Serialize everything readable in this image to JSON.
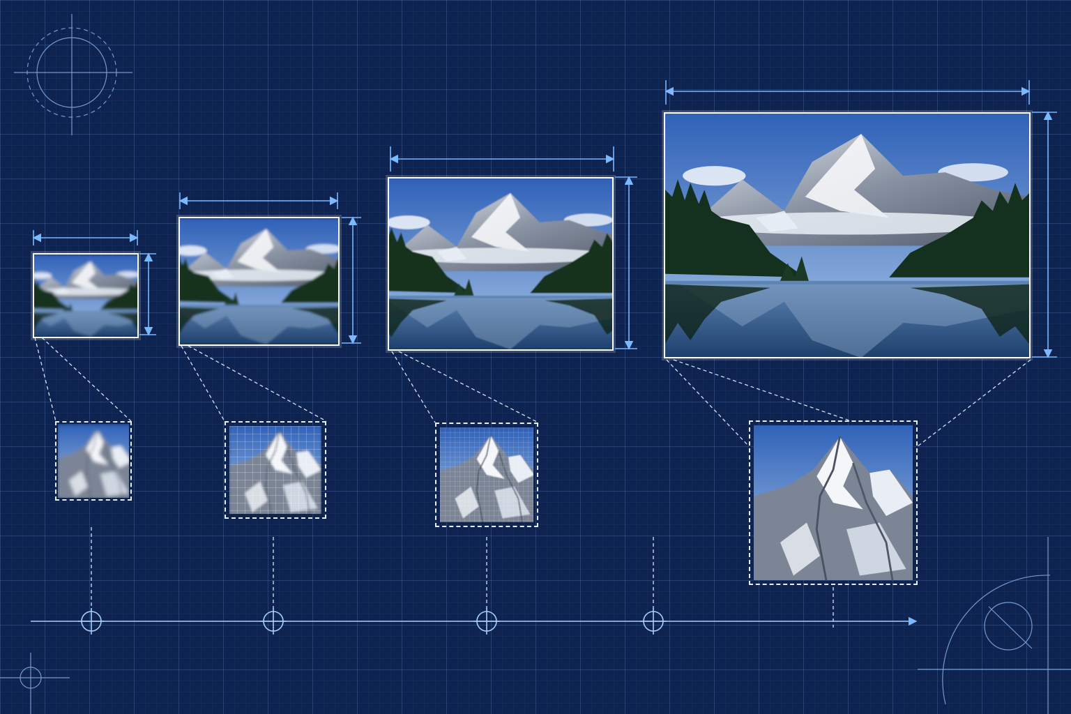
{
  "diagram": {
    "colors": {
      "background": "#0e2350",
      "grid": "#6aa8f0",
      "dimension_line": "#7ab8ff",
      "frame": "#ffffff",
      "sky": "#3f73c8",
      "snow": "#f2f4f8",
      "rock": "#7d8596",
      "forest": "#173024",
      "water": "#2c5a8c"
    },
    "stages": [
      {
        "id": "stage-1",
        "resolution_level": 1,
        "sharpness": "very-blurry"
      },
      {
        "id": "stage-2",
        "resolution_level": 2,
        "sharpness": "blurry"
      },
      {
        "id": "stage-3",
        "resolution_level": 3,
        "sharpness": "soft"
      },
      {
        "id": "stage-4",
        "resolution_level": 4,
        "sharpness": "sharp"
      }
    ],
    "details": [
      {
        "id": "detail-1",
        "style": "blurred"
      },
      {
        "id": "detail-2",
        "style": "pixelated"
      },
      {
        "id": "detail-3",
        "style": "fine-grid"
      },
      {
        "id": "detail-4",
        "style": "sharp"
      }
    ],
    "timeline": {
      "nodes": 4,
      "direction": "left-to-right"
    },
    "icons": [
      "crosshair-circle-icon",
      "crosshair-circle-icon",
      "arc-compass-icon",
      "crosshair-circle-icon"
    ]
  }
}
